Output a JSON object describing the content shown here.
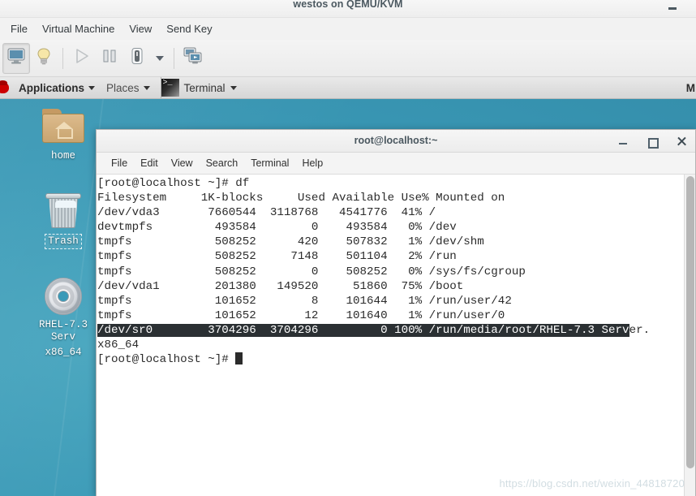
{
  "vm_window": {
    "title": "westos on QEMU/KVM",
    "minimize_label": "Minimize",
    "menus": [
      "File",
      "Virtual Machine",
      "View",
      "Send Key"
    ],
    "toolbar": [
      {
        "name": "console-view-button",
        "label": "Console"
      },
      {
        "name": "details-view-button",
        "label": "Details"
      },
      {
        "name": "run-button",
        "label": "Run"
      },
      {
        "name": "pause-button",
        "label": "Pause"
      },
      {
        "name": "shutdown-button",
        "label": "Shut Down"
      },
      {
        "name": "shutdown-dropdown-arrow",
        "label": "Shutdown options"
      },
      {
        "name": "snapshots-button",
        "label": "Manage snapshots"
      }
    ]
  },
  "guest": {
    "panel": {
      "logo": "redhat-logo-icon",
      "applications": "Applications",
      "places": "Places",
      "task_window": "Terminal",
      "clock": "M"
    },
    "desktop_icons": [
      {
        "name": "desktop-icon-home",
        "label": "home",
        "icon": "folder-home-icon",
        "selected": false
      },
      {
        "name": "desktop-icon-trash",
        "label": "Trash",
        "icon": "trash-icon",
        "selected": true
      },
      {
        "name": "desktop-icon-cdrom",
        "label": "RHEL-7.3 Serv",
        "label2": "x86_64",
        "icon": "cdrom-disc-icon",
        "selected": false
      }
    ]
  },
  "terminal": {
    "title": "root@localhost:~",
    "menus": [
      "File",
      "Edit",
      "View",
      "Search",
      "Terminal",
      "Help"
    ],
    "window_buttons": {
      "minimize": "Minimize",
      "maximize": "Maximize",
      "close": "Close"
    },
    "lines": [
      {
        "text": "[root@localhost ~]# df"
      },
      {
        "text": "Filesystem     1K-blocks     Used Available Use% Mounted on"
      },
      {
        "text": "/dev/vda3       7660544  3118768   4541776  41% /"
      },
      {
        "text": "devtmpfs         493584        0    493584   0% /dev"
      },
      {
        "text": "tmpfs            508252      420    507832   1% /dev/shm"
      },
      {
        "text": "tmpfs            508252     7148    501104   2% /run"
      },
      {
        "text": "tmpfs            508252        0    508252   0% /sys/fs/cgroup"
      },
      {
        "text": "/dev/vda1        201380   149520     51860  75% /boot"
      },
      {
        "text": "tmpfs            101652        8    101644   1% /run/user/42"
      },
      {
        "text": "tmpfs            101652       12    101640   1% /run/user/0"
      },
      {
        "selected": "/dev/sr0        3704296  3704296         0 100% /run/media/root/RHEL-7.3 Serv",
        "tail": "er."
      },
      {
        "text": "x86_64"
      },
      {
        "text": "[root@localhost ~]# ",
        "cursor": true
      }
    ],
    "scrollbar": "vertical-scrollbar"
  },
  "watermark": "https://blog.csdn.net/weixin_44818720"
}
